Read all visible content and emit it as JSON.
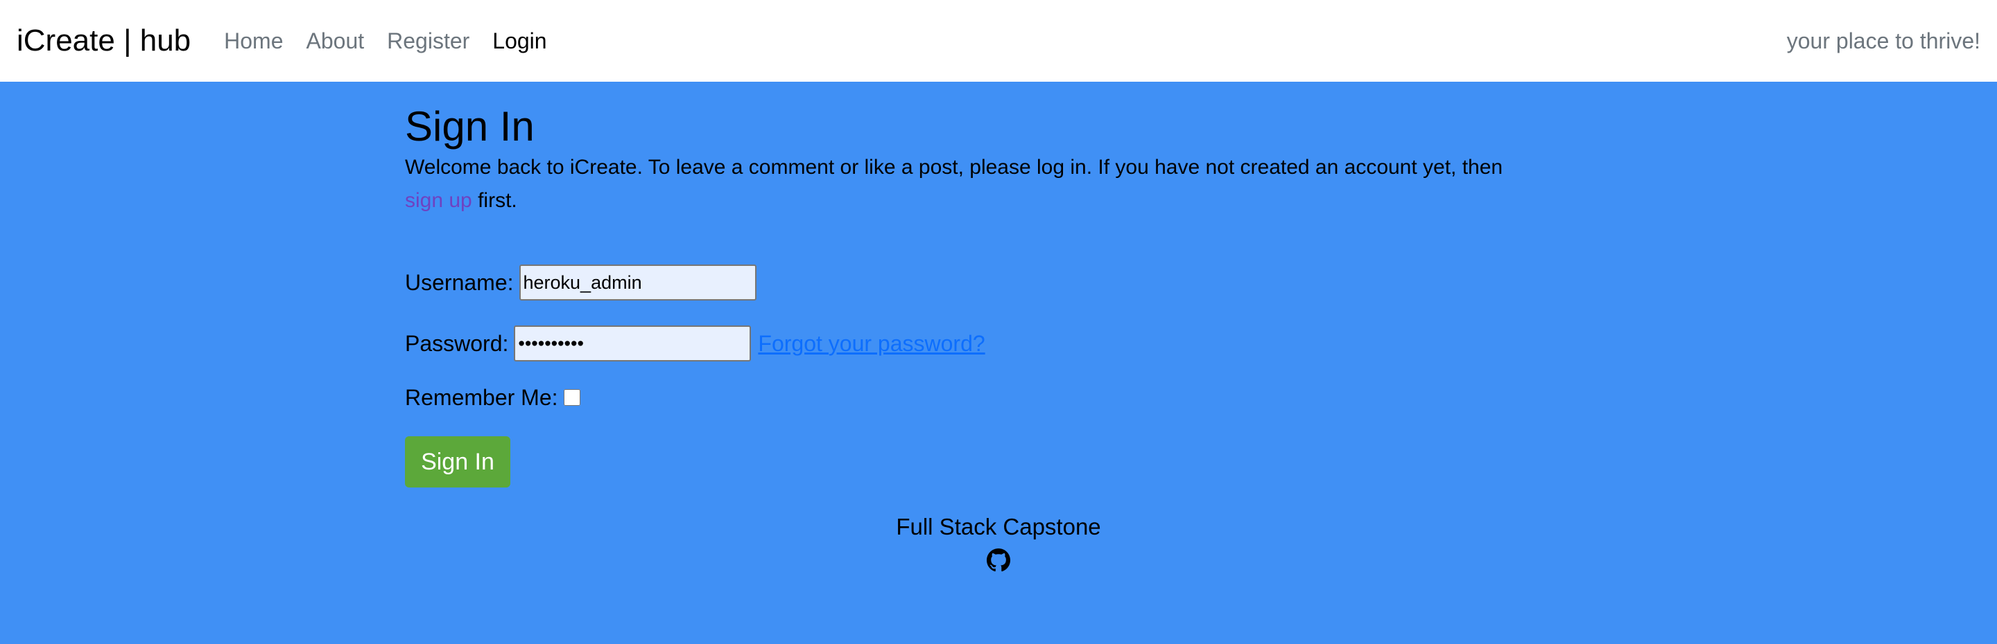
{
  "navbar": {
    "brand": "iCreate | hub",
    "links": [
      "Home",
      "About",
      "Register",
      "Login"
    ],
    "active_link": "Login",
    "tagline": "your place to thrive!"
  },
  "main": {
    "title": "Sign In",
    "intro_text": "Welcome back to iCreate. To leave a comment or like a post, please log in. If you have not created an account yet, then",
    "signup_link": "sign up",
    "intro_suffix": "first."
  },
  "form": {
    "username_label": "Username:",
    "username_value": "heroku_admin",
    "password_label": "Password:",
    "password_value": "••••••••••",
    "forgot_link": "Forgot your password?",
    "remember_label": "Remember Me:",
    "remember_checked": false,
    "submit_label": "Sign In"
  },
  "footer": {
    "title": "Full Stack Capstone",
    "icon": "github-icon"
  },
  "colors": {
    "background": "#4090f5",
    "navbar": "#ffffff",
    "button": "#5ca83a",
    "link": "#0d6efd",
    "visited_link": "#6f42c1"
  }
}
